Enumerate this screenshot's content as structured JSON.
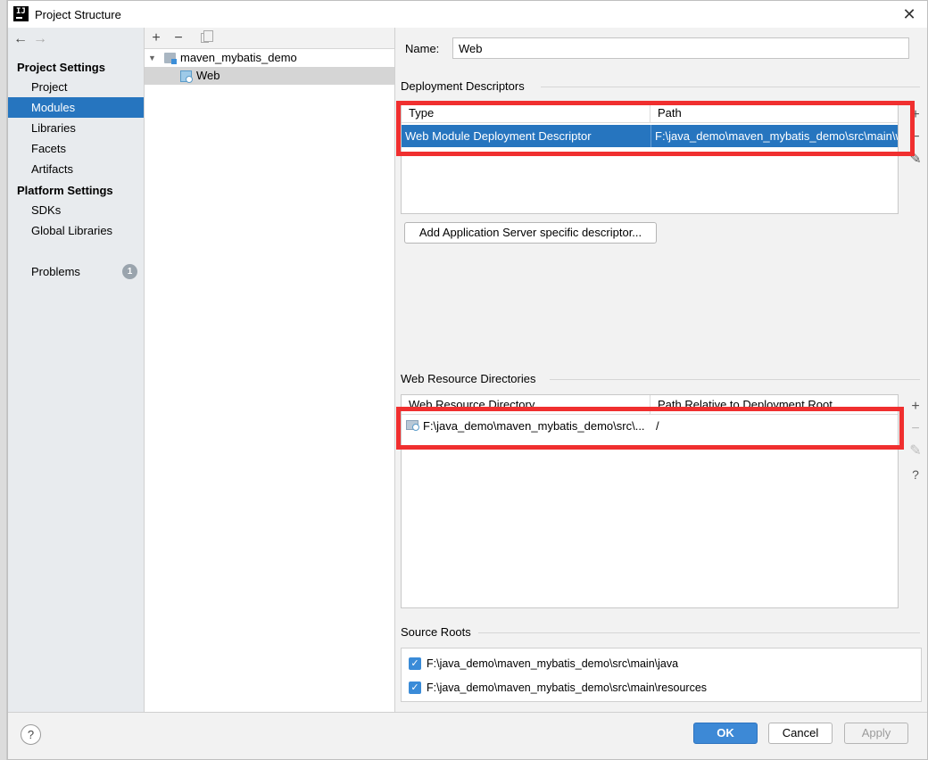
{
  "window": {
    "title": "Project Structure",
    "close_glyph": "✕"
  },
  "nav": {
    "back": "←",
    "forward": "→",
    "project_settings_header": "Project Settings",
    "platform_settings_header": "Platform Settings",
    "items": {
      "project": "Project",
      "modules": "Modules",
      "libraries": "Libraries",
      "facets": "Facets",
      "artifacts": "Artifacts",
      "sdks": "SDKs",
      "global_libraries": "Global Libraries",
      "problems": "Problems"
    },
    "problems_count": "1"
  },
  "tree": {
    "toolbar": {
      "add": "+",
      "remove": "−"
    },
    "module_name": "maven_mybatis_demo",
    "facet_name": "Web"
  },
  "facet": {
    "name_label": "Name:",
    "name_value": "Web",
    "deployment": {
      "title": "Deployment Descriptors",
      "columns": [
        "Type",
        "Path"
      ],
      "rows": [
        {
          "type": "Web Module Deployment Descriptor",
          "path": "F:\\java_demo\\maven_mybatis_demo\\src\\main\\w"
        }
      ],
      "add_server_button": "Add Application Server specific descriptor..."
    },
    "web_resources": {
      "title": "Web Resource Directories",
      "columns": [
        "Web Resource Directory",
        "Path Relative to Deployment Root"
      ],
      "rows": [
        {
          "directory": "F:\\java_demo\\maven_mybatis_demo\\src\\...",
          "relative_path": "/"
        }
      ]
    },
    "side_tools": {
      "add": "+",
      "remove": "−",
      "edit": "✎",
      "help": "?"
    },
    "source_roots": {
      "title": "Source Roots",
      "items": [
        {
          "path": "F:\\java_demo\\maven_mybatis_demo\\src\\main\\java",
          "checked": true
        },
        {
          "path": "F:\\java_demo\\maven_mybatis_demo\\src\\main\\resources",
          "checked": true
        }
      ]
    }
  },
  "footer": {
    "help": "?",
    "ok": "OK",
    "cancel": "Cancel",
    "apply": "Apply"
  },
  "colors": {
    "selection": "#2675bf",
    "annotation_red": "#f02f2f",
    "ok_button": "#3d89d6"
  }
}
